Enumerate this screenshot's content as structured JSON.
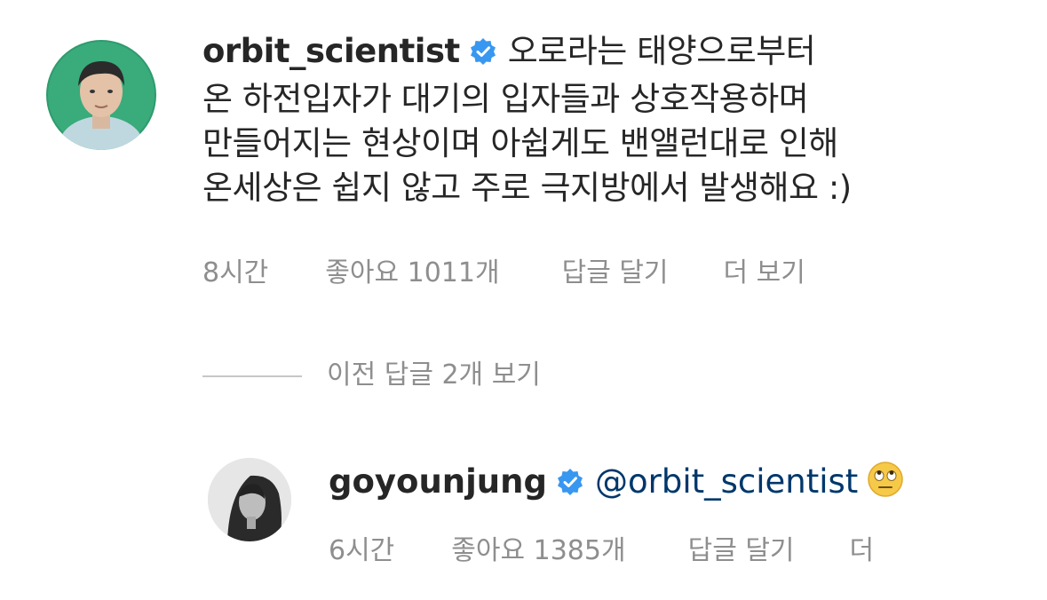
{
  "comment": {
    "username": "orbit_scientist",
    "text": "오로라는 태양으로부터 온 하전입자가 대기의 입자들과 상호작용하며 만들어지는 현상이며 아쉽게도 밴앨런대로 인해 온세상은 쉽지 않고 주로 극지방에서 발생해요 :)",
    "line1": "오로라는 태양으로부터",
    "line2": "온 하전입자가 대기의 입자들과 상호작용하며",
    "line3": "만들어지는 현상이며 아쉽게도 밴앨런대로 인해",
    "line4": "온세상은 쉽지 않고 주로 극지방에서 발생해요 :)",
    "time": "8시간",
    "likes": "좋아요 1011개",
    "reply_label": "답글 달기",
    "more_label": "더 보기",
    "avatar_icon": "profile-photo-man-green-background"
  },
  "view_replies": "이전 답글 2개 보기",
  "reply": {
    "username": "goyounjung",
    "mention": "@orbit_scientist",
    "emoji_icon": "eye-roll-emoji",
    "time": "6시간",
    "likes": "좋아요 1385개",
    "reply_label": "답글 달기",
    "more_label": "더",
    "avatar_icon": "profile-photo-woman-grayscale"
  },
  "colors": {
    "verified": "#3897f0",
    "meta_text": "#8e8e8e",
    "mention": "#00376b",
    "primary_text": "#262626"
  }
}
